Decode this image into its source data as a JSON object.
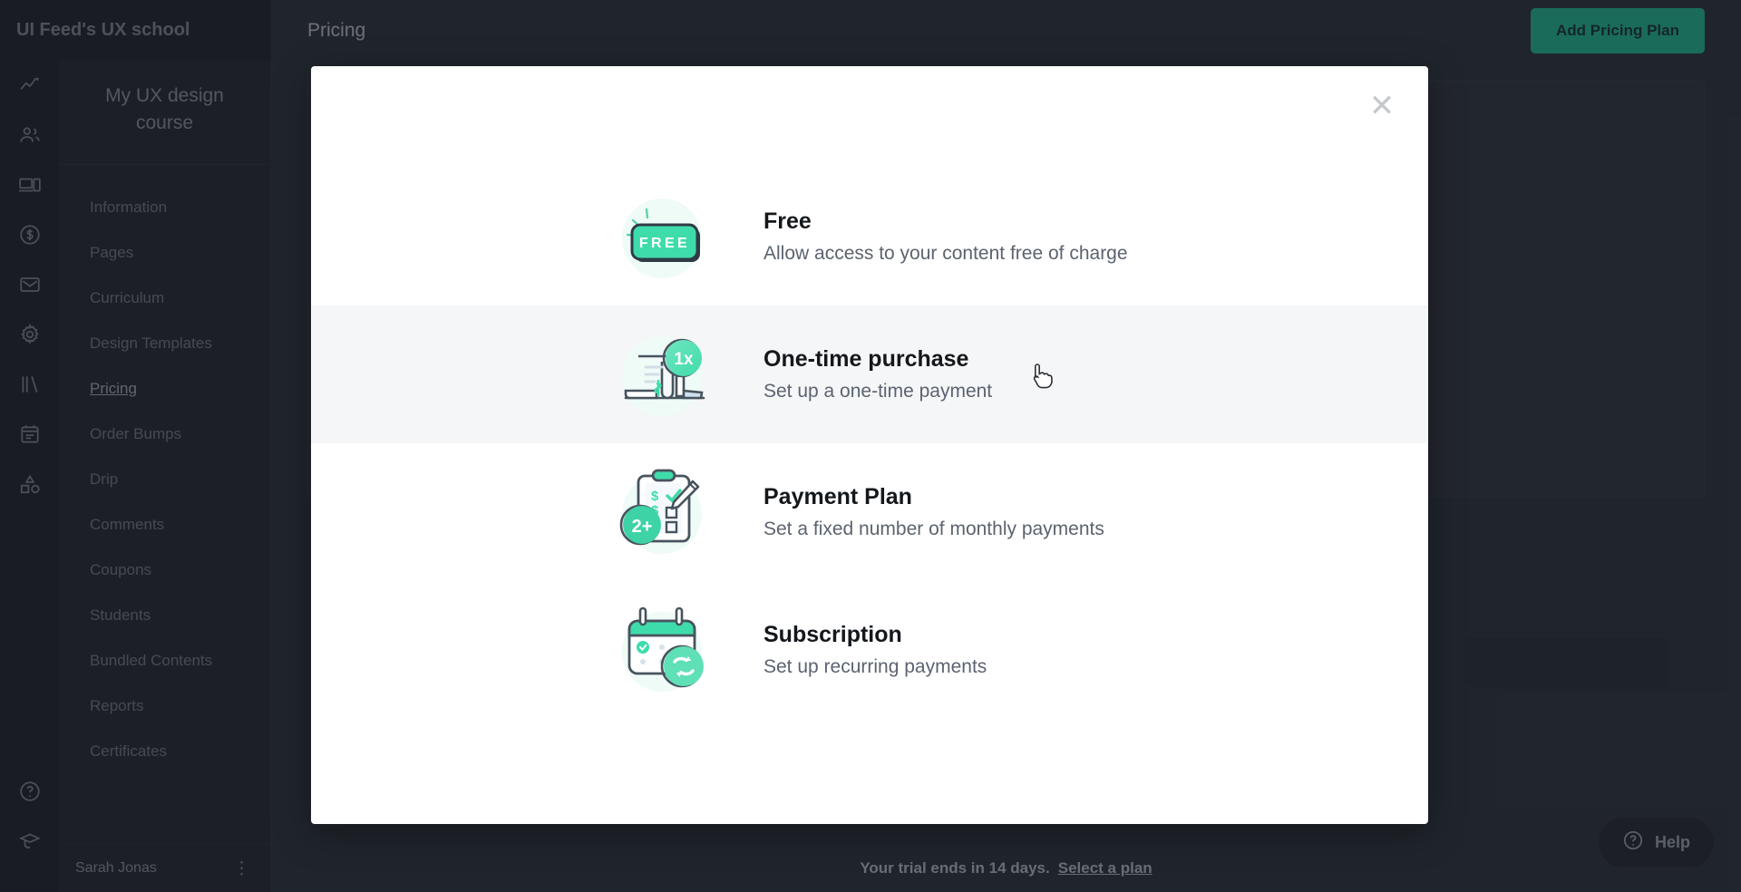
{
  "colors": {
    "brand_green": "#1ecf9c",
    "mint": "#3fdcab",
    "dark_sidebar": "#22262e",
    "dark_rail": "#1b1f26",
    "main_bg": "#2c313a",
    "ink": "#14181c"
  },
  "rail": {
    "icons": [
      "analytics-chart-icon",
      "people-icon",
      "devices-icon",
      "dollar-circle-icon",
      "mail-icon",
      "gear-icon",
      "library-books-icon",
      "calendar-notes-icon",
      "shapes-icon"
    ],
    "bottom_icons": [
      "help-circle-icon",
      "graduation-cap-icon"
    ]
  },
  "sidebar": {
    "brand": "UI Feed's UX school",
    "course_title": "My UX design course",
    "items": [
      {
        "label": "Information",
        "active": false
      },
      {
        "label": "Pages",
        "active": false
      },
      {
        "label": "Curriculum",
        "active": false
      },
      {
        "label": "Design Templates",
        "active": false
      },
      {
        "label": "Pricing",
        "active": true
      },
      {
        "label": "Order Bumps",
        "active": false
      },
      {
        "label": "Drip",
        "active": false
      },
      {
        "label": "Comments",
        "active": false
      },
      {
        "label": "Coupons",
        "active": false
      },
      {
        "label": "Students",
        "active": false
      },
      {
        "label": "Bundled Contents",
        "active": false
      },
      {
        "label": "Reports",
        "active": false
      },
      {
        "label": "Certificates",
        "active": false
      }
    ],
    "user_name": "Sarah Jonas",
    "user_menu_icon": "kebab-menu-icon"
  },
  "header": {
    "title": "Pricing",
    "add_plan_label": "Add Pricing Plan"
  },
  "trial": {
    "text": "Your trial ends in 14 days.",
    "link_label": "Select a plan"
  },
  "help": {
    "label": "Help",
    "icon": "question-circle-icon"
  },
  "modal": {
    "close_icon": "close-icon",
    "options": [
      {
        "id": "free",
        "title": "Free",
        "subtitle": "Allow access to your content free of charge",
        "art": "free-badge-illustration",
        "art_label": "FREE",
        "hovered": false
      },
      {
        "id": "one-time-purchase",
        "title": "One-time purchase",
        "subtitle": "Set up a one-time payment",
        "art": "receipt-one-time-illustration",
        "art_label": "1x",
        "hovered": true
      },
      {
        "id": "payment-plan",
        "title": "Payment Plan",
        "subtitle": "Set a fixed number of monthly payments",
        "art": "clipboard-installments-illustration",
        "art_label": "2+",
        "hovered": false
      },
      {
        "id": "subscription",
        "title": "Subscription",
        "subtitle": "Set up recurring payments",
        "art": "calendar-recurring-illustration",
        "art_label": "",
        "hovered": false
      }
    ]
  }
}
